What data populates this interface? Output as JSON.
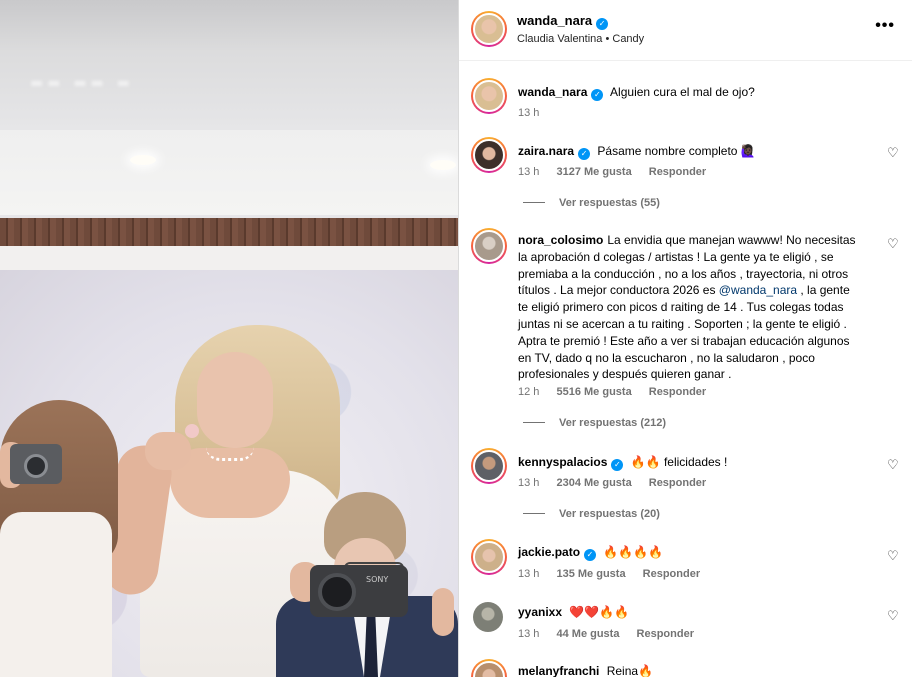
{
  "post": {
    "author": "wanda_nara",
    "audio": "Claudia Valentina • Candy",
    "more_icon": "more-horizontal-icon"
  },
  "photo": {
    "camera_brand": "SONY"
  },
  "caption": {
    "username": "wanda_nara",
    "text": "Alguien cura el mal de ojo?",
    "time": "13 h"
  },
  "comments": [
    {
      "username": "zaira.nara",
      "verified": true,
      "text": "Pásame nombre completo",
      "emoji": "🙋🏿‍♀️",
      "time": "13 h",
      "likes": "3127 Me gusta",
      "reply_label": "Responder",
      "view_replies": "Ver respuestas (55)"
    },
    {
      "username": "nora_colosimo",
      "verified": false,
      "text_before": "La envidia que manejan wawww! No necesitas la aprobación d colegas / artistas ! La gente ya te eligió , se premiaba a la conducción , no a los años , trayectoria, ni otros títulos . La mejor conductora 2026 es ",
      "mention": "@wanda_nara",
      "text_after": " , la gente te eligió primero con picos d raiting de 14 . Tus colegas todas juntas ni se acercan a tu raiting . Soporten ; la gente te eligió . Aptra te premió ! Este año a ver si trabajan educación algunos en TV, dado q no la escucharon , no la saludaron , poco profesionales y después quieren ganar .",
      "time": "12 h",
      "likes": "5516 Me gusta",
      "reply_label": "Responder",
      "view_replies": "Ver respuestas (212)"
    },
    {
      "username": "kennyspalacios",
      "verified": true,
      "emoji": "🔥🔥",
      "text": "felicidades !",
      "time": "13 h",
      "likes": "2304 Me gusta",
      "reply_label": "Responder",
      "view_replies": "Ver respuestas (20)"
    },
    {
      "username": "jackie.pato",
      "verified": true,
      "emoji": "🔥🔥🔥🔥",
      "time": "13 h",
      "likes": "135 Me gusta",
      "reply_label": "Responder"
    },
    {
      "username": "yyanixx",
      "verified": false,
      "emoji": "❤️❤️🔥🔥",
      "time": "13 h",
      "likes": "44 Me gusta",
      "reply_label": "Responder"
    },
    {
      "username": "melanyfranchi",
      "verified": false,
      "text": "Reina",
      "emoji": "🔥"
    }
  ],
  "icons": {
    "like": "heart-outline-icon",
    "verified": "verified-badge-icon"
  },
  "colors": {
    "verified_blue": "#0095f6",
    "mention": "#00376b",
    "meta_gray": "#737373"
  }
}
